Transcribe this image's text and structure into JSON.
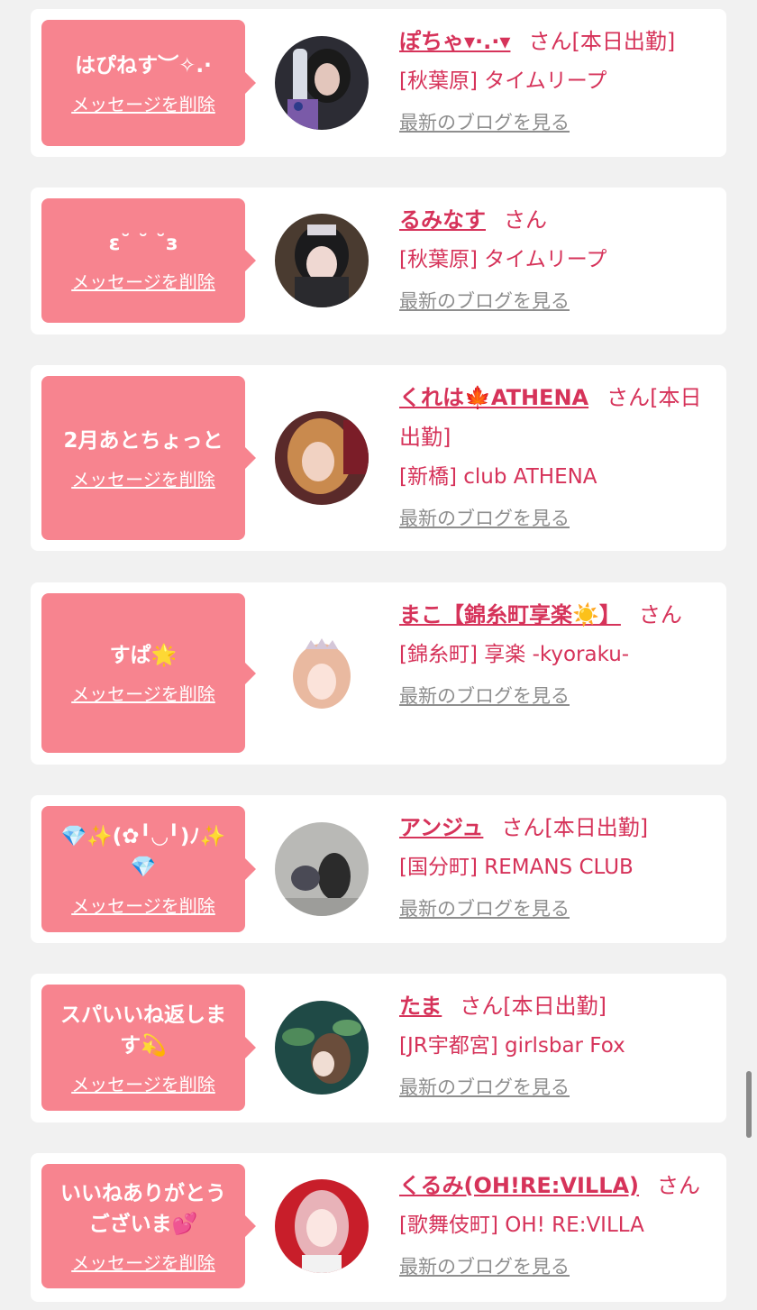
{
  "common": {
    "delete_label": "メッセージを削除",
    "blog_label": "最新のブログを見る"
  },
  "accent_colors": {
    "bubble": "#f7848f",
    "name_text": "#d6335a",
    "link_gray": "#8e8e8e"
  },
  "items": [
    {
      "message": "はぴねす︶✧.·",
      "name": "ぽちゃ▾·.·▾",
      "suffix": "さん[本日出勤]",
      "shop": "[秋葉原] タイムリープ",
      "avatar_icon": "avatar-photo"
    },
    {
      "message": "ε˘ ˘ ˘з",
      "name": "るみなす",
      "suffix": "さん",
      "shop": "[秋葉原] タイムリープ",
      "avatar_icon": "avatar-photo"
    },
    {
      "message": "2月あとちょっと",
      "name": "くれは🍁ATHENA",
      "suffix": "さん[本日出勤]",
      "shop": "[新橋] club ATHENA",
      "avatar_icon": "avatar-photo"
    },
    {
      "message": "すぱ🌟",
      "name": "まこ【錦糸町享楽☀️】",
      "suffix": "さん",
      "shop": "[錦糸町] 享楽 -kyoraku-",
      "avatar_icon": "avatar-photo"
    },
    {
      "message": "💎✨(✿╹◡╹)ﾉ✨💎",
      "name": "アンジュ",
      "suffix": "さん[本日出勤]",
      "shop": "[国分町] REMANS CLUB",
      "avatar_icon": "avatar-photo"
    },
    {
      "message": "スパいいね返します💫",
      "name": "たま",
      "suffix": "さん[本日出勤]",
      "shop": "[JR宇都宮] girlsbar Fox",
      "avatar_icon": "avatar-photo"
    },
    {
      "message": "いいねありがとうございま💕",
      "name": "くるみ(OH!RE:VILLA)",
      "suffix": "さん",
      "shop": "[歌舞伎町] OH! RE:VILLA",
      "avatar_icon": "avatar-photo"
    }
  ]
}
